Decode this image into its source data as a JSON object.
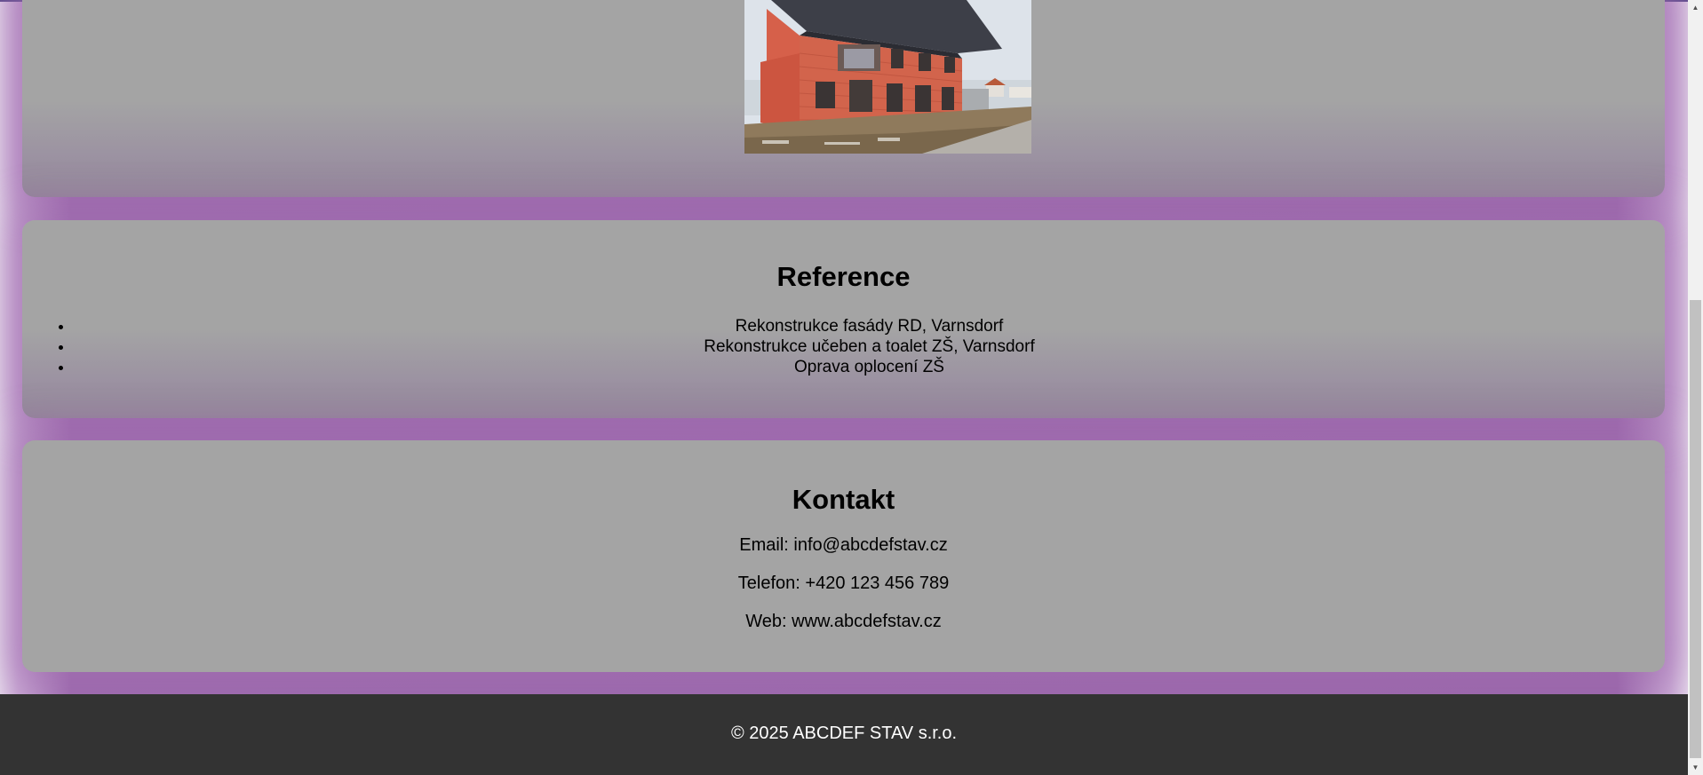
{
  "references": {
    "heading": "Reference",
    "items": [
      "Rekonstrukce fasády RD, Varnsdorf",
      "Rekonstrukce učeben a toalet ZŠ, Varnsdorf",
      "Oprava oplocení ZŠ"
    ]
  },
  "contact": {
    "heading": "Kontakt",
    "email": "Email: info@abcdefstav.cz",
    "phone": "Telefon: +420 123 456 789",
    "web": "Web: www.abcdefstav.cz"
  },
  "footer": {
    "copyright": "© 2025 ABCDEF STAV s.r.o."
  },
  "photo": {
    "subject": "building-under-construction"
  },
  "colors": {
    "background_accent": "#9a66ab",
    "card_gray": "#a4a4a4",
    "footer_bg": "#333333",
    "top_border": "#5a4a8a"
  },
  "scrollbar": {
    "up_icon": "arrow-up-icon",
    "down_icon": "arrow-down-icon"
  }
}
